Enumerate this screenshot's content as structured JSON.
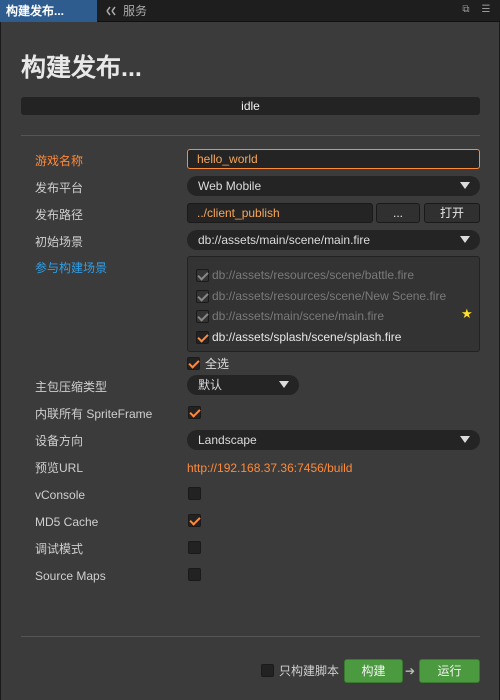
{
  "tabs": {
    "active": "构建发布...",
    "inactive": "服务"
  },
  "header": {
    "title": "构建发布...",
    "status": "idle"
  },
  "form": {
    "game_name": {
      "label": "游戏名称",
      "value": "hello_world"
    },
    "platform": {
      "label": "发布平台",
      "value": "Web Mobile"
    },
    "build_path": {
      "label": "发布路径",
      "value": "../client_publish",
      "browse_label": "...",
      "open_label": "打开"
    },
    "start_scene": {
      "label": "初始场景",
      "value": "db://assets/main/scene/main.fire"
    },
    "included_scenes": {
      "label": "参与构建场景",
      "items": [
        {
          "path": "db://assets/resources/scene/battle.fire",
          "checked": true,
          "enabled": false
        },
        {
          "path": "db://assets/resources/scene/New Scene.fire",
          "checked": true,
          "enabled": false
        },
        {
          "path": "db://assets/main/scene/main.fire",
          "checked": true,
          "enabled": false
        },
        {
          "path": "db://assets/splash/scene/splash.fire",
          "checked": true,
          "enabled": true
        }
      ],
      "select_all_label": "全选"
    },
    "compression": {
      "label": "主包压缩类型",
      "value": "默认"
    },
    "inline_spriteframe": {
      "label": "内联所有 SpriteFrame",
      "checked": true
    },
    "orientation": {
      "label": "设备方向",
      "value": "Landscape"
    },
    "preview_url": {
      "label": "预览URL",
      "value": "http://192.168.37.36:7456/build"
    },
    "vconsole": {
      "label": "vConsole",
      "checked": false
    },
    "md5_cache": {
      "label": "MD5 Cache",
      "checked": true
    },
    "debug_mode": {
      "label": "调试模式",
      "checked": false
    },
    "source_maps": {
      "label": "Source Maps",
      "checked": false
    }
  },
  "footer": {
    "build_script_only_label": "只构建脚本",
    "build_label": "构建",
    "run_label": "运行"
  },
  "colors": {
    "accent_orange": "#ff8a3a",
    "link_blue": "#2f9fe8",
    "button_green": "#4c9a3f",
    "tab_active": "#2e5c8f"
  }
}
